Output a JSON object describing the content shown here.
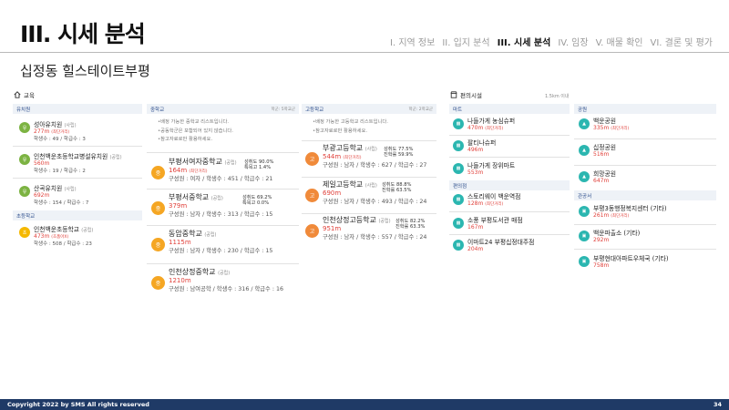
{
  "header": {
    "title": "III. 시세 분석",
    "nav": [
      {
        "label": "I. 지역 정보",
        "active": false
      },
      {
        "label": "II. 입지 분석",
        "active": false
      },
      {
        "label": "III. 시세 분석",
        "active": true
      },
      {
        "label": "IV. 임장",
        "active": false
      },
      {
        "label": "V. 매물 확인",
        "active": false
      },
      {
        "label": "VI. 결론 및 평가",
        "active": false
      }
    ],
    "subtitle": "십정동 힐스테이트부평"
  },
  "education": {
    "heading": "교육",
    "kindergarten": {
      "title": "유치원",
      "items": [
        {
          "badge": "유",
          "name": "성아유치원",
          "tag": "(사립)",
          "dist": "277m",
          "dist_note": "(최단거리)",
          "stats": "학생수 : 49 / 학급수 : 3"
        },
        {
          "badge": "유",
          "name": "인천백운초등학교병설유치원",
          "tag": "(공립)",
          "dist": "560m",
          "dist_note": "",
          "stats": "학생수 : 19 / 학급수 : 2"
        },
        {
          "badge": "유",
          "name": "산곡유치원",
          "tag": "(사립)",
          "dist": "692m",
          "dist_note": "",
          "stats": "학생수 : 154 / 학급수 : 7"
        }
      ]
    },
    "elementary": {
      "title": "초등학교",
      "items": [
        {
          "badge": "초",
          "name": "인천백운초등학교",
          "tag": "(공립)",
          "dist": "473m",
          "dist_note": "(초품아X)",
          "stats": "학생수 : 508 / 학급수 : 23"
        }
      ]
    },
    "middle": {
      "title": "중학교",
      "note": "학군: 5학교군",
      "notes": [
        "배정 가능한 중학교 리스트입니다.",
        "공동학군은 포함되어 있지 않습니다.",
        "참고자료로만 활용하세요."
      ],
      "items": [
        {
          "badge": "중",
          "name": "부평서여자중학교",
          "tag": "(공립)",
          "dist": "164m",
          "dist_note": "(최단거리)",
          "stats": "구성원 : 여자 / 학생수 : 451 / 학급수 : 21",
          "r1": "성취도 90.0%",
          "r2": "특목고 1.4%"
        },
        {
          "badge": "중",
          "name": "부평서중학교",
          "tag": "(공립)",
          "dist": "379m",
          "dist_note": "",
          "stats": "구성원 : 남자 / 학생수 : 313 / 학급수 : 15",
          "r1": "성취도 69.2%",
          "r2": "특목고 0.0%"
        },
        {
          "badge": "중",
          "name": "동암중학교",
          "tag": "(공립)",
          "dist": "1115m",
          "dist_note": "",
          "stats": "구성원 : 남자 / 학생수 : 230 / 학급수 : 15",
          "r1": "",
          "r2": ""
        },
        {
          "badge": "중",
          "name": "인천상정중학교",
          "tag": "(공립)",
          "dist": "1210m",
          "dist_note": "",
          "stats": "구성원 : 남여공학 / 학생수 : 316 / 학급수 : 16",
          "r1": "",
          "r2": ""
        }
      ]
    },
    "high": {
      "title": "고등학교",
      "note": "학군: 2학교군",
      "notes": [
        "배정 가능한 고등학교 리스트입니다.",
        "참고자료로만 활용하세요."
      ],
      "items": [
        {
          "badge": "고",
          "name": "부광고등학교",
          "tag": "(사립)",
          "dist": "544m",
          "dist_note": "(최단거리)",
          "stats": "구성원 : 남자 / 학생수 : 627 / 학급수 : 27",
          "r1": "성취도 77.5%",
          "r2": "진학률 59.9%"
        },
        {
          "badge": "고",
          "name": "제일고등학교",
          "tag": "(사립)",
          "dist": "690m",
          "dist_note": "",
          "stats": "구성원 : 남자 / 학생수 : 493 / 학급수 : 24",
          "r1": "성취도 88.8%",
          "r2": "진학률 63.5%"
        },
        {
          "badge": "고",
          "name": "인천상정고등학교",
          "tag": "(공립)",
          "dist": "951m",
          "dist_note": "",
          "stats": "구성원 : 남자 / 학생수 : 557 / 학급수 : 24",
          "r1": "성취도 82.2%",
          "r2": "진학률 63.3%"
        }
      ]
    }
  },
  "convenience": {
    "heading": "편의시설",
    "dist_note": "1.5km 이내",
    "mart": {
      "title": "마트",
      "items": [
        {
          "name": "나들가게 농심슈퍼",
          "dist": "470m",
          "dist_note": "(최단거리)"
        },
        {
          "name": "팔티나슈퍼",
          "dist": "496m",
          "dist_note": ""
        },
        {
          "name": "나들가게 장위마트",
          "dist": "553m",
          "dist_note": ""
        }
      ]
    },
    "dept": {
      "title": "편의점",
      "items": [
        {
          "name": "스토리웨이 백운역점",
          "dist": "128m",
          "dist_note": "(최단거리)"
        },
        {
          "name": "소풍 부평도서관 매점",
          "dist": "167m",
          "dist_note": ""
        },
        {
          "name": "이마트24 부평십정대주점",
          "dist": "204m",
          "dist_note": ""
        }
      ]
    },
    "park": {
      "title": "공원",
      "items": [
        {
          "name": "백운공원",
          "dist": "335m",
          "dist_note": "(최단거리)"
        },
        {
          "name": "십정공원",
          "dist": "516m",
          "dist_note": ""
        },
        {
          "name": "희망공원",
          "dist": "647m",
          "dist_note": ""
        }
      ]
    },
    "public": {
      "title": "관공서",
      "items": [
        {
          "name": "부평3동행정복지센터 (기타)",
          "dist": "261m",
          "dist_note": "(최단거리)"
        },
        {
          "name": "백운파출소 (기타)",
          "dist": "292m",
          "dist_note": ""
        },
        {
          "name": "부평현대아파트우체국 (기타)",
          "dist": "758m",
          "dist_note": ""
        }
      ]
    }
  },
  "footer": {
    "copyright": "Copyright 2022 by SMS All rights reserved",
    "page": "34"
  }
}
